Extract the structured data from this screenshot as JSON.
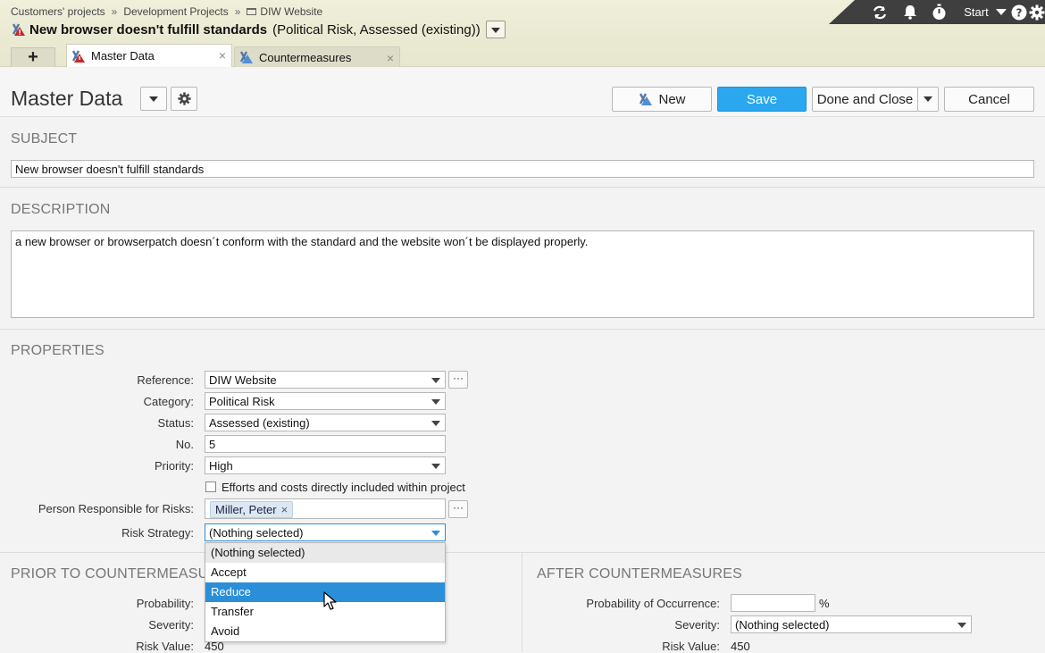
{
  "breadcrumb": [
    "Customers' projects",
    "Development Projects",
    "DIW Website"
  ],
  "title": {
    "main": "New browser doesn't fulfill standards",
    "sub": "(Political Risk, Assessed (existing))"
  },
  "top_tools": {
    "start_label": "Start"
  },
  "tabs": [
    {
      "label": "Master Data",
      "active": true
    },
    {
      "label": "Countermeasures",
      "active": false
    }
  ],
  "toolbar": {
    "page_title": "Master Data",
    "new_label": "New",
    "save_label": "Save",
    "done_close_label": "Done and Close",
    "cancel_label": "Cancel"
  },
  "subject": {
    "title": "SUBJECT",
    "value": "New browser doesn't fulfill standards"
  },
  "description": {
    "title": "DESCRIPTION",
    "value": "a new browser or browserpatch doesn´t conform with the standard and the website won´t be displayed properly."
  },
  "properties": {
    "title": "PROPERTIES",
    "reference_label": "Reference:",
    "reference_value": "DIW Website",
    "category_label": "Category:",
    "category_value": "Political Risk",
    "status_label": "Status:",
    "status_value": "Assessed (existing)",
    "no_label": "No.",
    "no_value": "5",
    "priority_label": "Priority:",
    "priority_value": "High",
    "efforts_label": "Efforts and costs directly included within project",
    "person_label": "Person Responsible for Risks:",
    "person_value": "Miller, Peter",
    "strategy_label": "Risk Strategy:",
    "strategy_value": "(Nothing selected)",
    "strategy_options": [
      "(Nothing selected)",
      "Accept",
      "Reduce",
      "Transfer",
      "Avoid"
    ]
  },
  "prior": {
    "title": "PRIOR TO COUNTERMEASURES",
    "probability_label": "Probability:",
    "severity_label": "Severity:",
    "risk_value_label": "Risk Value:",
    "risk_value": "450"
  },
  "after": {
    "title": "AFTER COUNTERMEASURES",
    "probability_label": "Probability of Occurrence:",
    "percent": "%",
    "severity_label": "Severity:",
    "severity_value": "(Nothing selected)",
    "risk_value_label": "Risk Value:",
    "risk_value": "450"
  },
  "colors": {
    "accent": "#2aa7ef",
    "selected": "#2a8fd8",
    "dark_bar": "#3f3f3f",
    "header_bg": "#efefda"
  }
}
